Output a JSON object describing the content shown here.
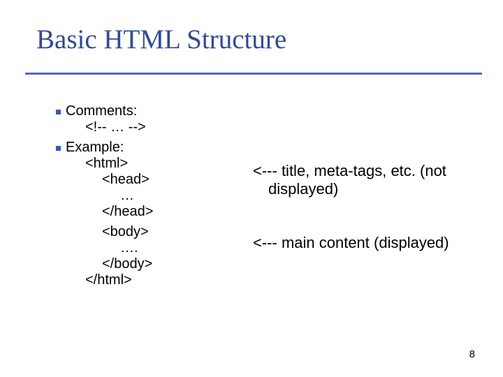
{
  "title": "Basic HTML Structure",
  "bullets": {
    "b0": {
      "label": "Comments:",
      "line": "<!-- … -->"
    },
    "b1": {
      "label": "Example:",
      "lines": {
        "l0": "<html>",
        "l1": "<head>",
        "l2": "…",
        "l3": "</head>",
        "l4": "<body>",
        "l5": "….",
        "l6": "</body>",
        "l7": "</html>"
      }
    }
  },
  "annotations": {
    "a0": "<--- title, meta-tags, etc. (not displayed)",
    "a1": "<--- main content (displayed)"
  },
  "page_number": "8"
}
